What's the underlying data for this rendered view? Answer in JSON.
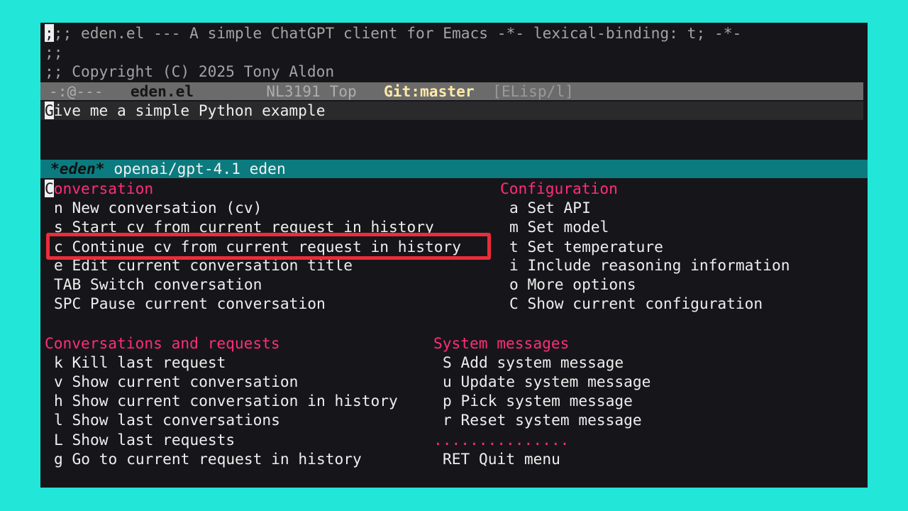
{
  "editor": {
    "line1_rest": ";; eden.el --- A simple ChatGPT client for Emacs -*- lexical-binding: t; -*-",
    "line1_cursor_char": ";",
    "line2": ";;",
    "line3": ";; Copyright (C) 2025 Tony Aldon"
  },
  "modeline": {
    "state": "-:@---",
    "buffer_name": "eden.el",
    "position": "NL3191 Top",
    "vc": "Git:master",
    "mode": "[ELisp/l]"
  },
  "minibuffer": {
    "cursor_char": "G",
    "text": "ive me a simple Python example"
  },
  "menu_header": {
    "buffer": "*eden*",
    "model": "openai/gpt-4.1",
    "name": "eden"
  },
  "groups": {
    "conversation": {
      "title_cursor": "C",
      "title_rest": "onversation",
      "items": [
        {
          "key": "n",
          "label": "New conversation (cv)"
        },
        {
          "key": "s",
          "label": "Start cv from current request in history"
        },
        {
          "key": "c",
          "label": "Continue cv from current request in history"
        },
        {
          "key": "e",
          "label": "Edit current conversation title"
        },
        {
          "key": "TAB",
          "label": "Switch conversation"
        },
        {
          "key": "SPC",
          "label": "Pause current conversation"
        }
      ]
    },
    "configuration": {
      "title": "Configuration",
      "items": [
        {
          "key": "a",
          "label": "Set API"
        },
        {
          "key": "m",
          "label": "Set model"
        },
        {
          "key": "t",
          "label": "Set temperature"
        },
        {
          "key": "i",
          "label": "Include reasoning information"
        },
        {
          "key": "o",
          "label": "More options"
        },
        {
          "key": "C",
          "label": "Show current configuration"
        }
      ]
    },
    "requests": {
      "title": "Conversations and requests",
      "items": [
        {
          "key": "k",
          "label": "Kill last request"
        },
        {
          "key": "v",
          "label": "Show current conversation"
        },
        {
          "key": "h",
          "label": "Show current conversation in history"
        },
        {
          "key": "l",
          "label": "Show last conversations"
        },
        {
          "key": "L",
          "label": "Show last requests"
        },
        {
          "key": "g",
          "label": "Go to current request in history"
        }
      ]
    },
    "system": {
      "title": "System messages",
      "items": [
        {
          "key": "S",
          "label": "Add system message"
        },
        {
          "key": "u",
          "label": "Update system message"
        },
        {
          "key": "p",
          "label": "Pick system message"
        },
        {
          "key": "r",
          "label": "Reset system message"
        }
      ],
      "separator": "...............",
      "quit": {
        "key": "RET",
        "label": "Quit menu"
      }
    }
  },
  "colors": {
    "background": "#22e6d8",
    "terminal": "#16161a",
    "heading": "#ff2d7a",
    "header_line": "#0b7b7f",
    "highlight_box": "#ec2c3a"
  }
}
